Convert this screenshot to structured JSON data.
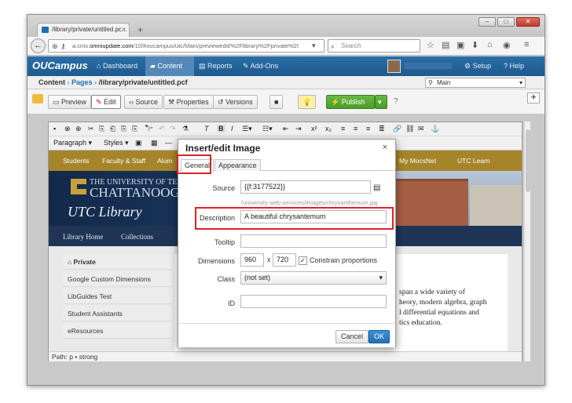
{
  "browser": {
    "tab_title": "/library/private/untitled.pc...",
    "tab_close": "×",
    "new_tab": "+",
    "url_prefix": "a.cms.",
    "url_host": "omniupdate.com",
    "url_path": "/10/#oucampus/utc/Main/previewedit/%2Flibrary%2Fprivate%2I",
    "search_placeholder": "Search",
    "win_minimize": "–",
    "win_maximize": "□",
    "win_close": "✕"
  },
  "app": {
    "logo": "OUCampus",
    "nav": [
      "Dashboard",
      "Content",
      "Reports",
      "Add-Ons"
    ],
    "setup": "Setup",
    "help": "Help"
  },
  "breadcrumb": {
    "root": "Content",
    "pages": "Pages",
    "path": "/library/private/untitled.pcf",
    "site": "Main"
  },
  "toolbar": {
    "preview": "Preview",
    "edit": "Edit",
    "source": "Source",
    "properties": "Properties",
    "versions": "Versions",
    "publish": "Publish"
  },
  "editor": {
    "format_select": "Paragraph",
    "styles_select": "Styles",
    "path_label": "Path:",
    "path_value": "p • strong"
  },
  "site": {
    "topnav": [
      "Students",
      "Faculty & Staff",
      "Alum",
      "My MocsNet",
      "UTC Learn"
    ],
    "uni_line1": "THE UNIVERSITY OF TENNESS",
    "uni_line2": "CHATTANOOG",
    "library": "UTC Library",
    "bar_items": [
      "Library Home",
      "Collections"
    ],
    "sidebar": [
      "Private",
      "Google Custom Dimensions",
      "LibGuides Test",
      "Student Assistants",
      "eResources"
    ],
    "body_lines": [
      "span a wide variety of",
      "heory, modern algebra, graph",
      "l differential equations and",
      "tics education."
    ]
  },
  "dialog": {
    "title": "Insert/edit Image",
    "close": "×",
    "tabs": [
      "General",
      "Appearance"
    ],
    "source_label": "Source",
    "source_value": "{{f:3177522}}",
    "source_hint": "/university-web-services/images/chrysanthemum.jpg",
    "description_label": "Description",
    "description_value": "A beautiful chrysantemum",
    "tooltip_label": "Tooltip",
    "tooltip_value": "",
    "dimensions_label": "Dimensions",
    "width": "960",
    "times": "x",
    "height": "720",
    "constrain": "Constrain proportions",
    "class_label": "Class",
    "class_value": "(not set)",
    "id_label": "ID",
    "id_value": "",
    "cancel": "Cancel",
    "ok": "OK"
  },
  "colors": {
    "accent": "#1f6fb5",
    "publish": "#4b9a2c",
    "highlight": "#d9232a",
    "site_gold": "#a5842a",
    "site_navy": "#1e3556"
  }
}
